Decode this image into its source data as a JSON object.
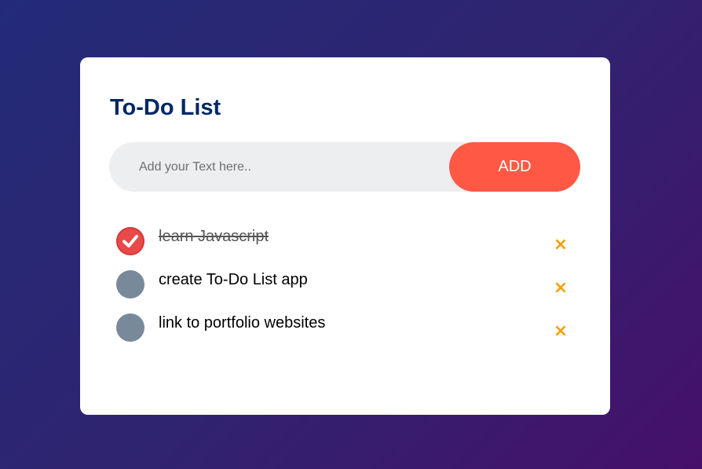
{
  "app": {
    "title": "To-Do List"
  },
  "input": {
    "placeholder": "Add your Text here..",
    "value": ""
  },
  "add_button": {
    "label": "ADD"
  },
  "tasks": [
    {
      "text": "learn Javascript",
      "done": true,
      "delete_icon": "×"
    },
    {
      "text": "create To-Do List app",
      "done": false,
      "delete_icon": "×"
    },
    {
      "text": "link to portfolio websites",
      "done": false,
      "delete_icon": "×"
    }
  ],
  "colors": {
    "accent": "#ff5945",
    "title": "#002765",
    "checked": "#e84a4a",
    "unchecked": "#78899a",
    "delete": "#f5a000"
  }
}
